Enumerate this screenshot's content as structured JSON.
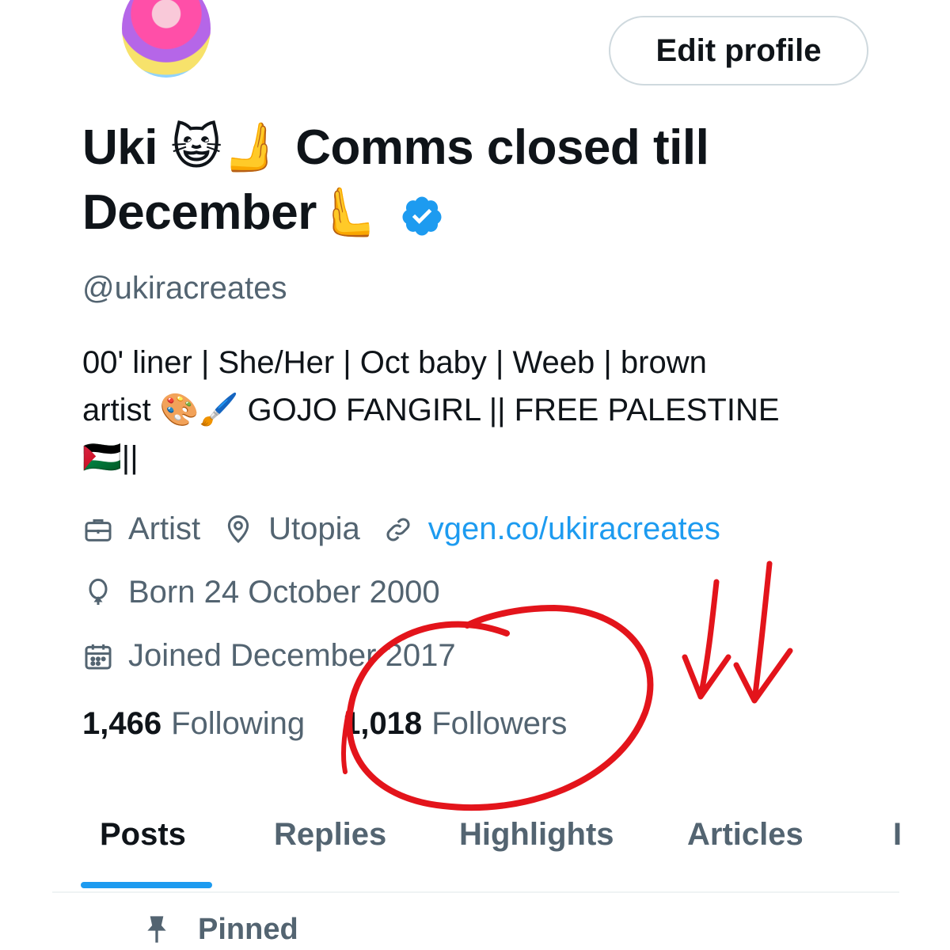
{
  "profile": {
    "edit_button_label": "Edit profile",
    "name_line1": "Uki 😺🫸 Comms closed till",
    "name_line2": "December🫷",
    "handle": "@ukiracreates",
    "bio_line1": "00' liner | She/Her | Oct baby | Weeb | brown",
    "bio_line2": "artist 🎨🖌️ GOJO FANGIRL || FREE PALESTINE",
    "bio_line3": "🇵🇸||",
    "profession": "Artist",
    "location": "Utopia",
    "website": "vgen.co/ukiracreates",
    "birthday": "Born 24 October 2000",
    "joined": "Joined December 2017"
  },
  "stats": {
    "following_count": "1,466",
    "following_label": "Following",
    "followers_count": "1,018",
    "followers_label": "Followers"
  },
  "tabs": {
    "posts": "Posts",
    "replies": "Replies",
    "highlights": "Highlights",
    "articles": "Articles",
    "overflow": "I"
  },
  "pinned_label": "Pinned",
  "colors": {
    "accent": "#1d9bf0",
    "text_primary": "#0f1419",
    "text_secondary": "#536471",
    "annotation_red": "#e3141b"
  },
  "icons": {
    "profession": "briefcase-icon",
    "location": "map-pin-icon",
    "website": "link-icon",
    "birthday": "balloon-icon",
    "joined": "calendar-icon",
    "verified": "verified-badge-icon",
    "pinned": "pin-icon"
  }
}
